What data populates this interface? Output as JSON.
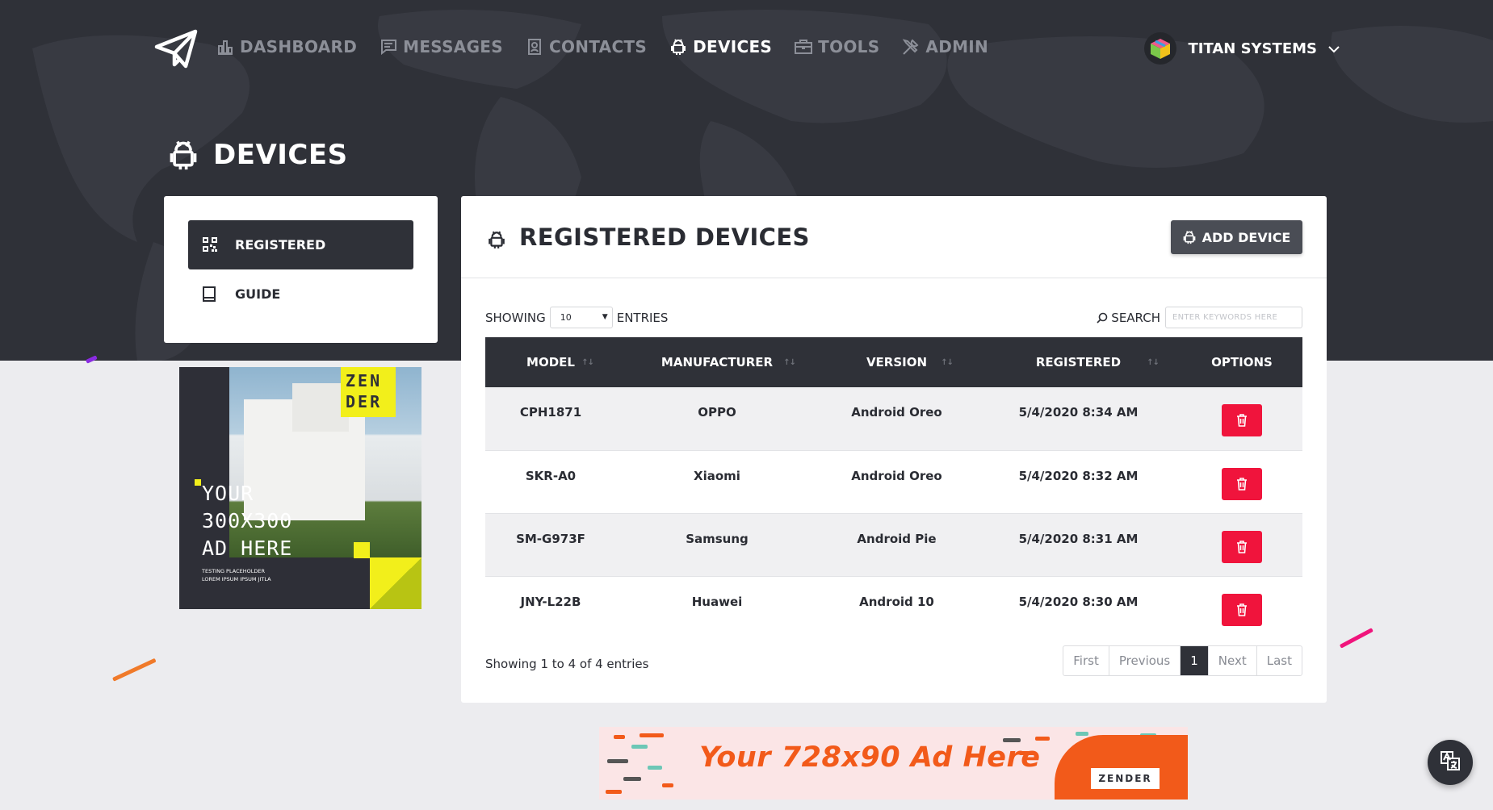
{
  "nav": {
    "items": [
      {
        "label": "DASHBOARD",
        "icon": "bar-chart-icon",
        "active": false
      },
      {
        "label": "MESSAGES",
        "icon": "message-icon",
        "active": false
      },
      {
        "label": "CONTACTS",
        "icon": "contact-card-icon",
        "active": false
      },
      {
        "label": "DEVICES",
        "icon": "android-icon",
        "active": true
      },
      {
        "label": "TOOLS",
        "icon": "briefcase-icon",
        "active": false
      },
      {
        "label": "ADMIN",
        "icon": "tools-icon",
        "active": false
      }
    ],
    "account": "TITAN SYSTEMS"
  },
  "page": {
    "title": "DEVICES"
  },
  "sidebar": {
    "items": [
      {
        "label": "REGISTERED",
        "icon": "qr-code-icon",
        "active": true
      },
      {
        "label": "GUIDE",
        "icon": "book-icon",
        "active": false
      }
    ]
  },
  "ad300": {
    "brand_line1": "ZEN",
    "brand_line2": "DER",
    "headline": "YOUR\n300X300\nAD HERE",
    "sub": "TESTING PLACEHOLDER\nLOREM IPSUM IPSUM JITLA"
  },
  "card": {
    "title": "REGISTERED DEVICES",
    "add_button": "ADD DEVICE",
    "showing_label": "SHOWING",
    "entries_value": "10",
    "entries_label": "ENTRIES",
    "search_label": "SEARCH",
    "search_placeholder": "ENTER KEYWORDS HERE",
    "columns": [
      "MODEL",
      "MANUFACTURER",
      "VERSION",
      "REGISTERED",
      "OPTIONS"
    ],
    "rows": [
      [
        "CPH1871",
        "OPPO",
        "Android Oreo",
        "5/4/2020 8:34 AM"
      ],
      [
        "SKR-A0",
        "Xiaomi",
        "Android Oreo",
        "5/4/2020 8:32 AM"
      ],
      [
        "SM-G973F",
        "Samsung",
        "Android Pie",
        "5/4/2020 8:31 AM"
      ],
      [
        "JNY-L22B",
        "Huawei",
        "Android 10",
        "5/4/2020 8:30 AM"
      ]
    ],
    "footer_info": "Showing 1 to 4 of 4 entries",
    "pagination": [
      "First",
      "Previous",
      "1",
      "Next",
      "Last"
    ],
    "current_page": "1"
  },
  "ad728": {
    "text": "Your 728x90 Ad Here",
    "brand": "ZENDER"
  },
  "colors": {
    "dark": "#2f3138",
    "danger": "#f0143c",
    "accent_yellow": "#f2ef1b",
    "ad_orange": "#f25a1a"
  }
}
